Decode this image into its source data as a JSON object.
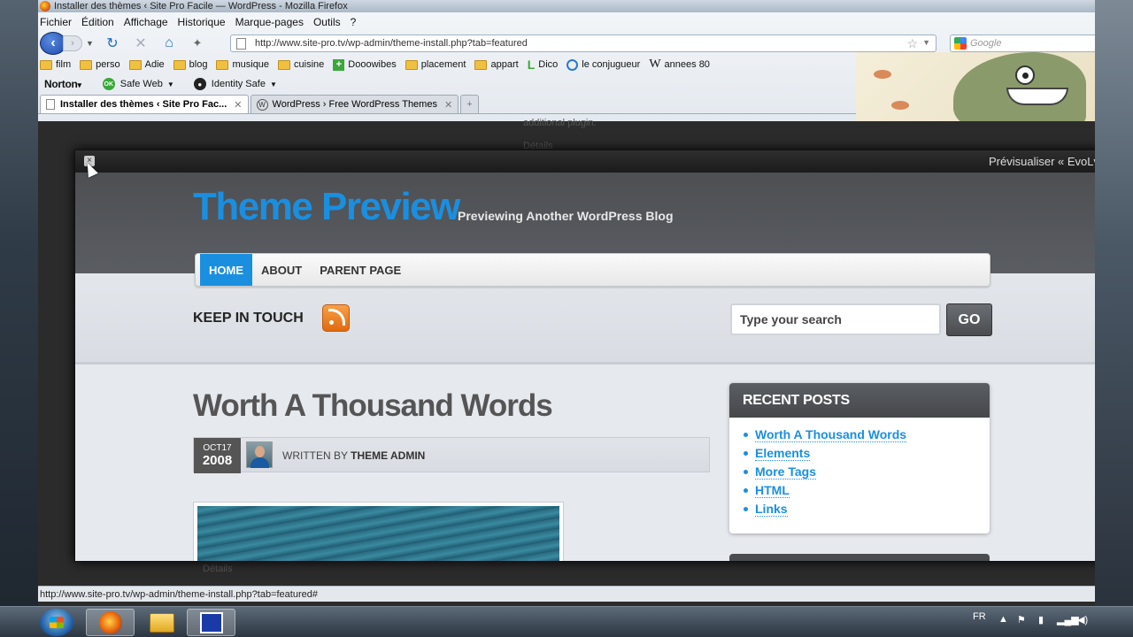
{
  "window": {
    "title": "Installer des thèmes ‹ Site Pro Facile — WordPress - Mozilla Firefox"
  },
  "menubar": [
    "Fichier",
    "Édition",
    "Affichage",
    "Historique",
    "Marque-pages",
    "Outils",
    "?"
  ],
  "navbar": {
    "url": "http://www.site-pro.tv/wp-admin/theme-install.php?tab=featured",
    "search_placeholder": "Google"
  },
  "bookmarks": [
    {
      "label": "film",
      "icon": "folder-icon"
    },
    {
      "label": "perso",
      "icon": "folder-icon"
    },
    {
      "label": "Adie",
      "icon": "folder-icon"
    },
    {
      "label": "blog",
      "icon": "folder-icon"
    },
    {
      "label": "musique",
      "icon": "folder-icon"
    },
    {
      "label": "cuisine",
      "icon": "folder-icon"
    },
    {
      "label": "Dooowibes",
      "icon": "plus-icon"
    },
    {
      "label": "placement",
      "icon": "folder-icon"
    },
    {
      "label": "appart",
      "icon": "folder-icon"
    },
    {
      "label": "Dico",
      "icon": "dico-icon"
    },
    {
      "label": "le conjugueur",
      "icon": "conjugueur-icon"
    },
    {
      "label": "annees 80",
      "icon": "wikipedia-icon"
    }
  ],
  "norton": {
    "logo": "Norton",
    "safe_web": "Safe Web",
    "identity_safe": "Identity Safe",
    "ok_badge": "OK"
  },
  "tabs": [
    {
      "label": "Installer des thèmes ‹ Site Pro Fac...",
      "active": true
    },
    {
      "label": "WordPress › Free WordPress Themes",
      "active": false
    }
  ],
  "admin_bg": {
    "text1": "additional plugin.",
    "text2": "Détails",
    "text3": "Détails"
  },
  "modal": {
    "title": "Prévisualiser « EvoLv",
    "close": "×"
  },
  "theme": {
    "logo": "Theme Preview",
    "tagline": "Previewing Another WordPress Blog",
    "nav": [
      "HOME",
      "ABOUT",
      "PARENT PAGE"
    ],
    "keep_in_touch": "KEEP IN TOUCH",
    "search_placeholder": "Type your search",
    "go": "GO",
    "post": {
      "title": "Worth A Thousand Words",
      "month_day": "OCT17",
      "year": "2008",
      "written_by": "WRITTEN BY",
      "author": "THEME ADMIN"
    },
    "recent_posts": {
      "heading": "RECENT POSTS",
      "items": [
        "Worth A Thousand Words",
        "Elements",
        "More Tags",
        "HTML",
        "Links"
      ]
    }
  },
  "statusbar": {
    "text": "http://www.site-pro.tv/wp-admin/theme-install.php?tab=featured#"
  },
  "taskbar": {
    "lang": "FR"
  }
}
